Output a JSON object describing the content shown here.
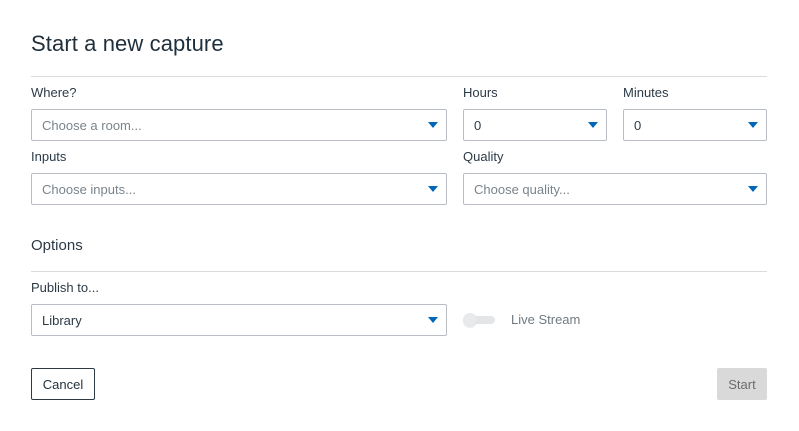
{
  "dialog": {
    "title": "Start a new capture"
  },
  "where": {
    "label": "Where?",
    "value": "Choose a room..."
  },
  "hours": {
    "label": "Hours",
    "value": "0"
  },
  "minutes": {
    "label": "Minutes",
    "value": "0"
  },
  "inputs": {
    "label": "Inputs",
    "value": "Choose inputs..."
  },
  "quality": {
    "label": "Quality",
    "value": "Choose quality..."
  },
  "options": {
    "heading": "Options",
    "publish_label": "Publish to...",
    "publish_value": "Library",
    "live_stream_label": "Live Stream",
    "live_stream_enabled": false
  },
  "actions": {
    "cancel_label": "Cancel",
    "start_label": "Start"
  },
  "colors": {
    "accent": "#0067b8",
    "border": "#b8bec4",
    "disabled_button": "#d9d9d9"
  }
}
